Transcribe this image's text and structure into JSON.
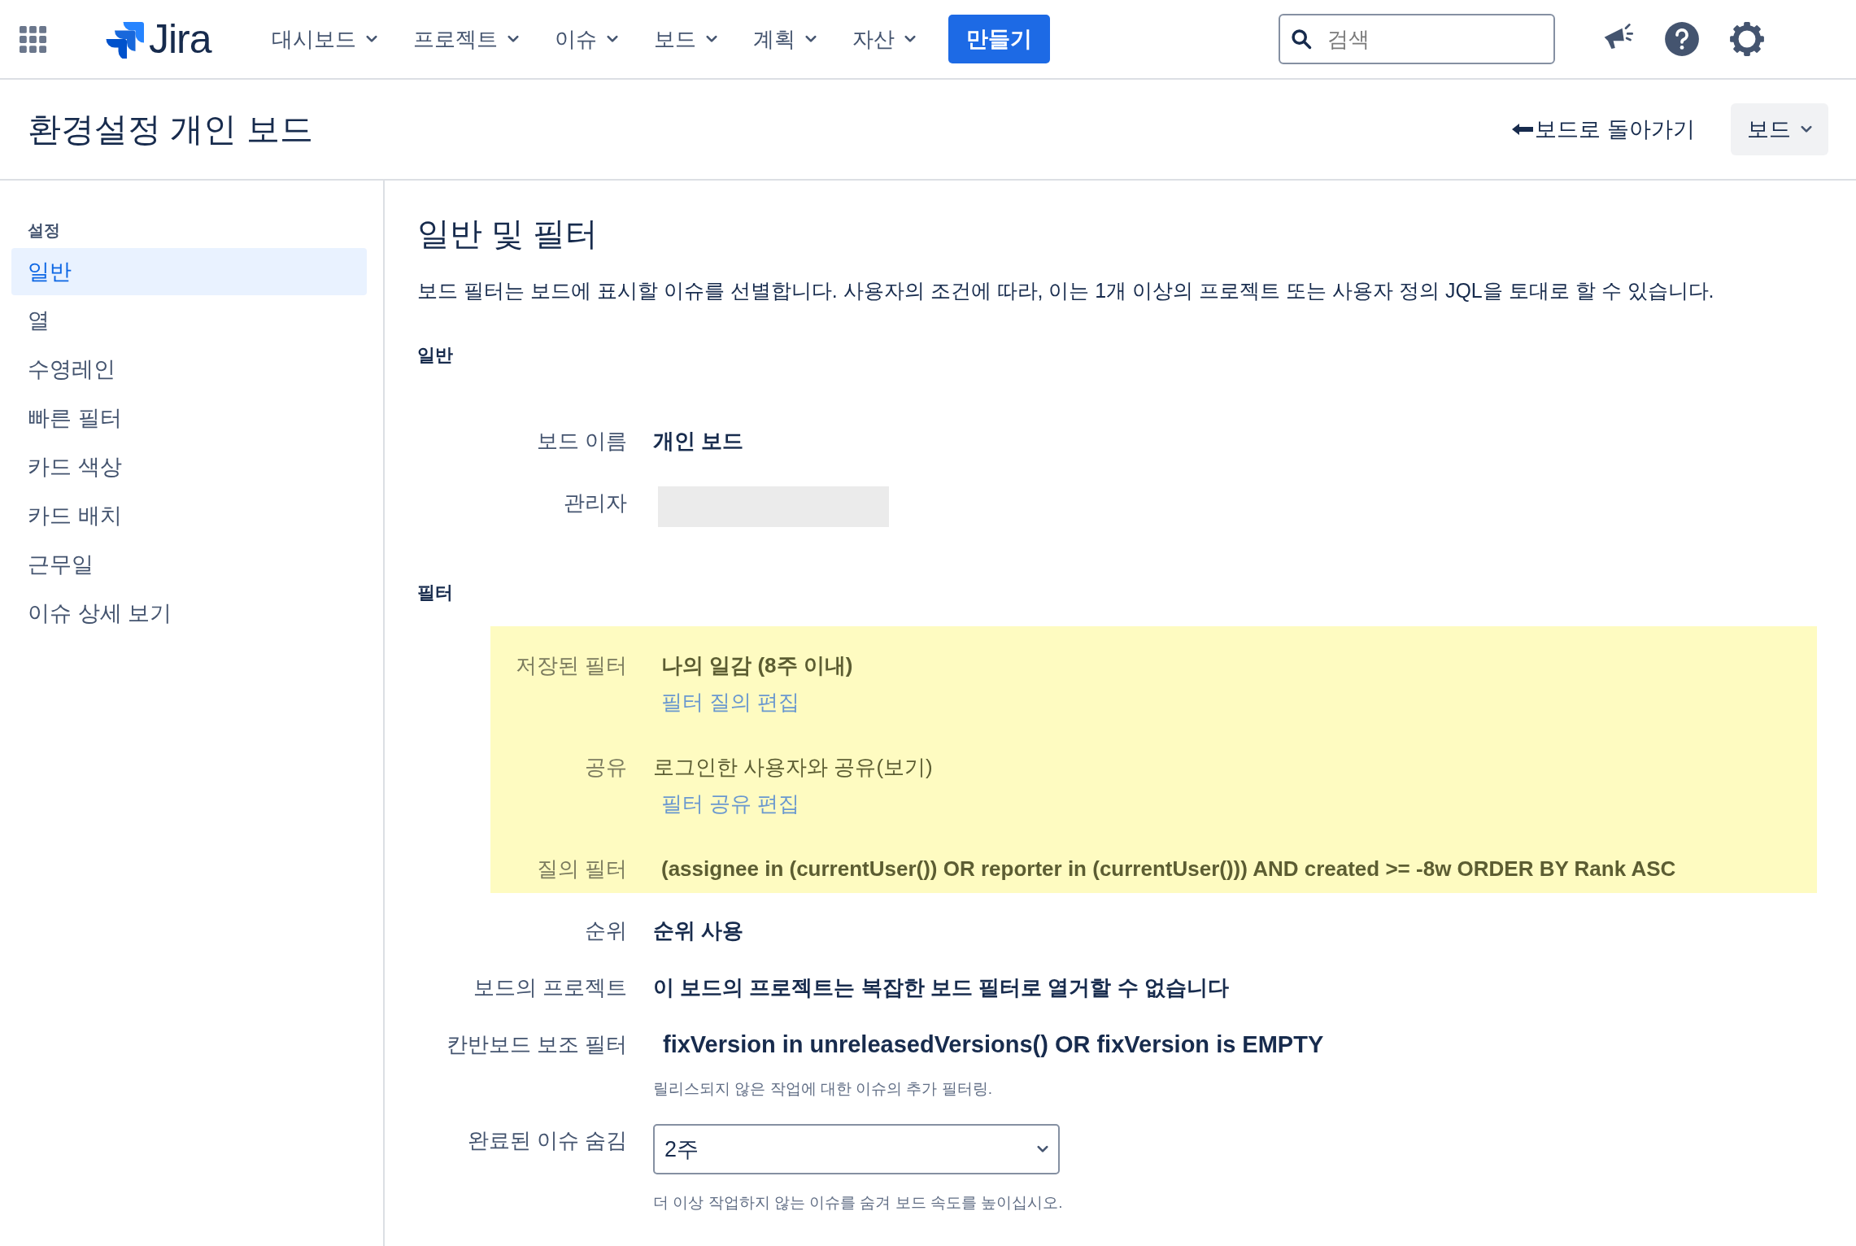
{
  "topbar": {
    "logo": "Jira",
    "nav": [
      {
        "label": "대시보드"
      },
      {
        "label": "프로젝트"
      },
      {
        "label": "이슈"
      },
      {
        "label": "보드"
      },
      {
        "label": "계획"
      },
      {
        "label": "자산"
      }
    ],
    "create_button": "만들기",
    "search": {
      "placeholder": "검색"
    }
  },
  "header": {
    "title": "환경설정 개인 보드",
    "back_link": "보드로 돌아가기",
    "board_button": "보드"
  },
  "sidebar": {
    "heading": "설정",
    "items": [
      {
        "label": "일반",
        "selected": true
      },
      {
        "label": "열",
        "selected": false
      },
      {
        "label": "수영레인",
        "selected": false
      },
      {
        "label": "빠른 필터",
        "selected": false
      },
      {
        "label": "카드 색상",
        "selected": false
      },
      {
        "label": "카드 배치",
        "selected": false
      },
      {
        "label": "근무일",
        "selected": false
      },
      {
        "label": "이슈 상세 보기",
        "selected": false
      }
    ]
  },
  "main": {
    "title": "일반 및 필터",
    "description": "보드 필터는 보드에 표시할 이슈를 선별합니다. 사용자의 조건에 따라, 이는 1개 이상의 프로젝트 또는 사용자 정의 JQL을 토대로 할 수 있습니다.",
    "general": {
      "heading": "일반",
      "fields": [
        {
          "kind": "text",
          "label": "보드 이름",
          "value": "개인 보드"
        },
        {
          "kind": "redacted",
          "label": "관리자"
        }
      ]
    },
    "filter": {
      "heading": "필터",
      "highlighted_fields": [
        {
          "kind": "text",
          "label": "저장된 필터",
          "value": "나의 일감 (8주 이내)",
          "link": "필터 질의 편집"
        },
        {
          "kind": "plain",
          "label": "공유",
          "value": "로그인한 사용자와 공유(보기)",
          "link": "필터 공유 편집"
        },
        {
          "kind": "text",
          "label": "질의 필터",
          "value": "(assignee in (currentUser()) OR reporter in (currentUser())) AND created >= -8w ORDER BY Rank ASC"
        }
      ],
      "fields": [
        {
          "kind": "text",
          "label": "순위",
          "value": "순위 사용"
        },
        {
          "kind": "text",
          "label": "보드의 프로젝트",
          "value": "이 보드의 프로젝트는 복잡한 보드 필터로 열거할 수 없습니다"
        },
        {
          "kind": "code",
          "label": "칸반보드 보조 필터",
          "value": "fixVersion in unreleasedVersions() OR fixVersion is EMPTY",
          "hint": "릴리스되지 않은 작업에 대한 이슈의 추가 필터링."
        },
        {
          "kind": "select",
          "label": "완료된 이슈 숨김",
          "value": "2주",
          "hint": "더 이상 작업하지 않는 이슈를 숨겨 보드 속도를 높이십시오."
        }
      ]
    }
  }
}
